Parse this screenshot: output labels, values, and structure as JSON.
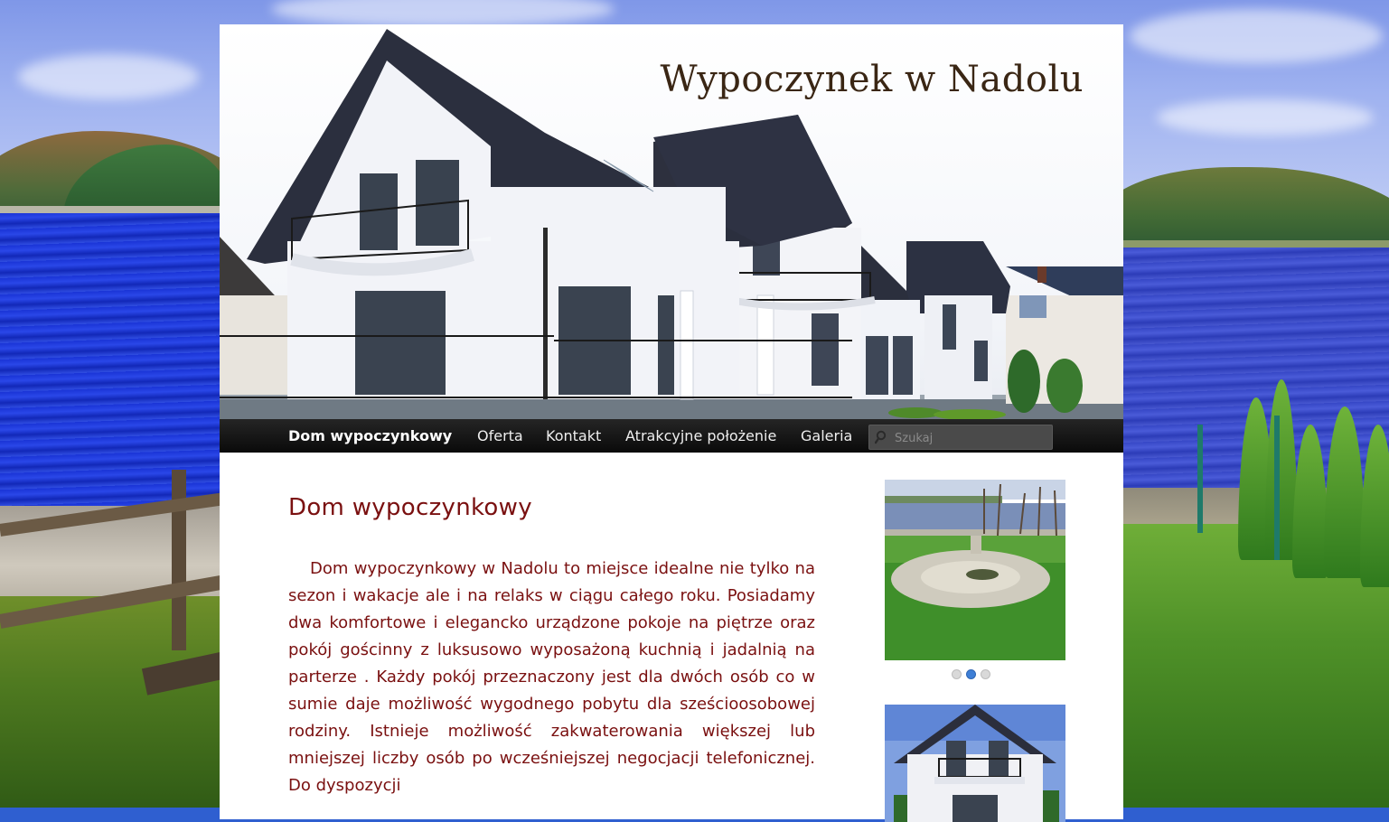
{
  "site": {
    "title": "Wypoczynek w Nadolu"
  },
  "nav": {
    "items": [
      {
        "label": "Dom wypoczynkowy",
        "active": true
      },
      {
        "label": "Oferta",
        "active": false
      },
      {
        "label": "Kontakt",
        "active": false
      },
      {
        "label": "Atrakcyjne położenie",
        "active": false
      },
      {
        "label": "Galeria",
        "active": false
      }
    ],
    "search_placeholder": "Szukaj"
  },
  "main": {
    "page_title": "Dom wypoczynkowy",
    "body": "Dom wypoczynkowy w Nadolu to miejsce idealne nie tylko na sezon i wakacje ale i na relaks w ciągu całego roku. Posiadamy dwa komfortowe i elegancko urządzone pokoje na piętrze oraz pokój gościnny z luksusowo wyposażoną kuchnią i jadalnią na parterze . Każdy pokój przeznaczony jest dla dwóch osób co w sumie daje możliwość wygodnego pobytu dla sześcioosobowej rodziny. Istnieje możliwość zakwaterowania większej lub mniejszej liczby osób po wcześniejszej negocjacji telefonicznej. Do dyspozycji"
  },
  "sidebar": {
    "slider": {
      "slide_count": 3,
      "active_index": 1
    }
  },
  "colors": {
    "content_text": "#7a1010",
    "nav_bg": "#111111",
    "slider_dot_active": "#3e7fd6"
  }
}
